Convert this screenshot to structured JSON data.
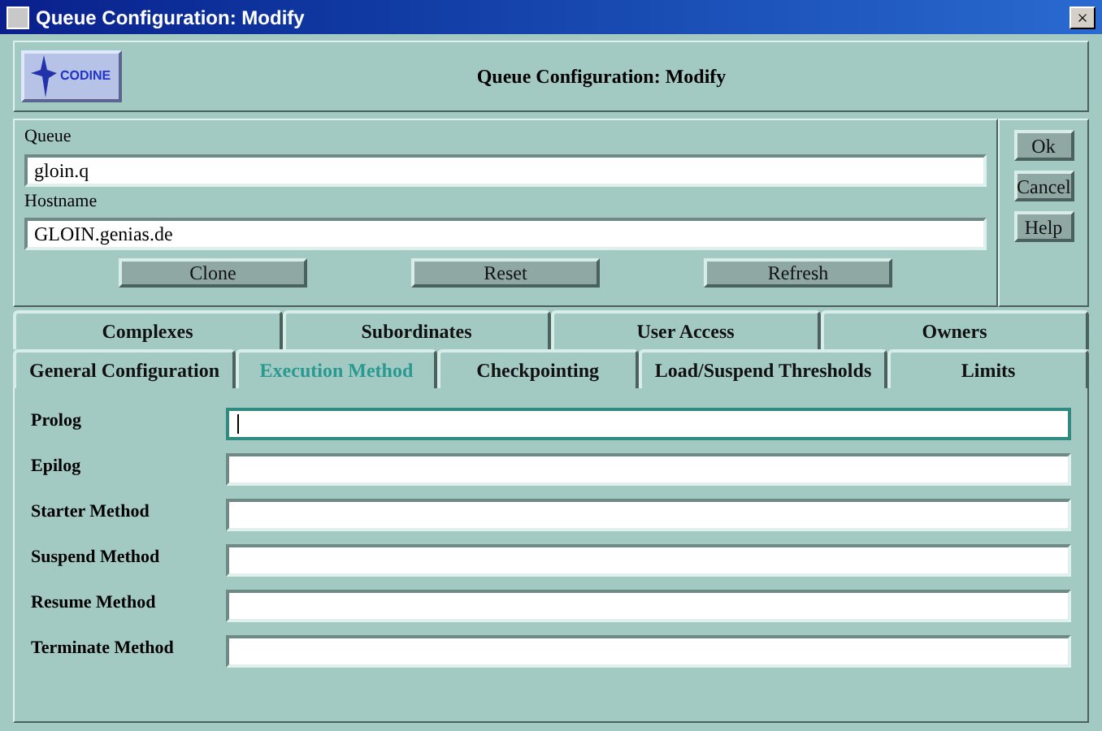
{
  "window": {
    "title": "Queue Configuration: Modify",
    "close": "×"
  },
  "logo": {
    "text": "CODINE"
  },
  "header": {
    "title": "Queue Configuration: Modify"
  },
  "queue": {
    "label": "Queue",
    "value": "gloin.q"
  },
  "hostname": {
    "label": "Hostname",
    "value": "GLOIN.genias.de"
  },
  "actions": [
    "Clone",
    "Reset",
    "Refresh"
  ],
  "side_buttons": [
    "Ok",
    "Cancel",
    "Help"
  ],
  "tab_rows": [
    [
      {
        "label": "Complexes",
        "selected": false
      },
      {
        "label": "Subordinates",
        "selected": false
      },
      {
        "label": "User Access",
        "selected": false
      },
      {
        "label": "Owners",
        "selected": false
      }
    ],
    [
      {
        "label": "General Configuration",
        "selected": false
      },
      {
        "label": "Execution Method",
        "selected": true
      },
      {
        "label": "Checkpointing",
        "selected": false
      },
      {
        "label": "Load/Suspend Thresholds",
        "selected": false
      },
      {
        "label": "Limits",
        "selected": false
      }
    ]
  ],
  "fields": [
    {
      "label": "Prolog",
      "focused": true
    },
    {
      "label": "Epilog",
      "focused": false
    },
    {
      "label": "Starter Method",
      "focused": false
    },
    {
      "label": "Suspend Method",
      "focused": false
    },
    {
      "label": "Resume Method",
      "focused": false
    },
    {
      "label": "Terminate Method",
      "focused": false
    }
  ]
}
